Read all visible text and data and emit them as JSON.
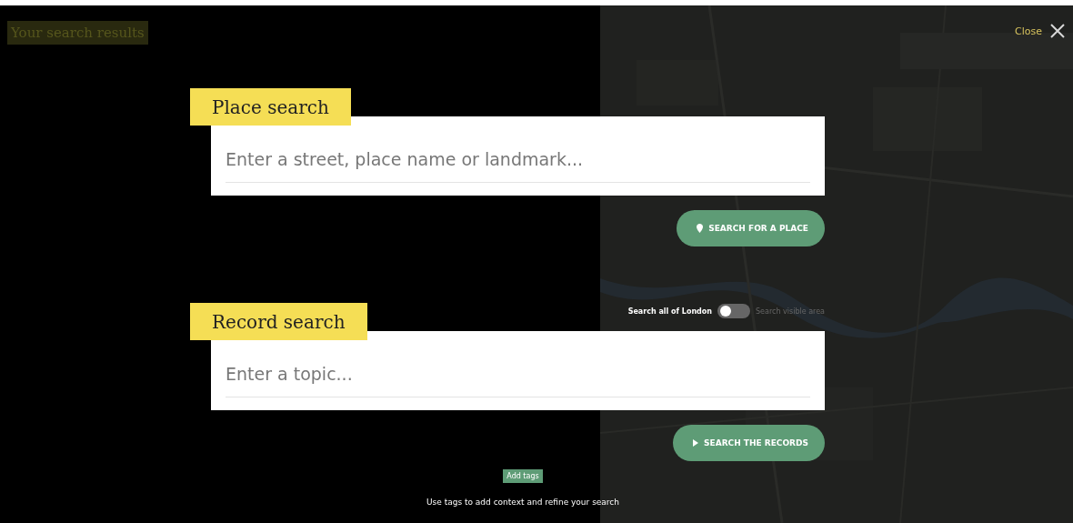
{
  "header": {
    "title": "Your search results",
    "close_label": "Close"
  },
  "place_search": {
    "heading": "Place search",
    "placeholder": "Enter a street, place name or landmark...",
    "button": "SEARCH FOR A PLACE"
  },
  "record_search": {
    "heading": "Record search",
    "scope_toggle": {
      "left_label": "Search all of London",
      "right_label": "Search visible area",
      "on": false
    },
    "placeholder": "Enter a topic...",
    "button": "SEARCH THE RECORDS"
  },
  "tags": {
    "button": "Add tags",
    "hint": "Use tags to add context and refine your search"
  }
}
